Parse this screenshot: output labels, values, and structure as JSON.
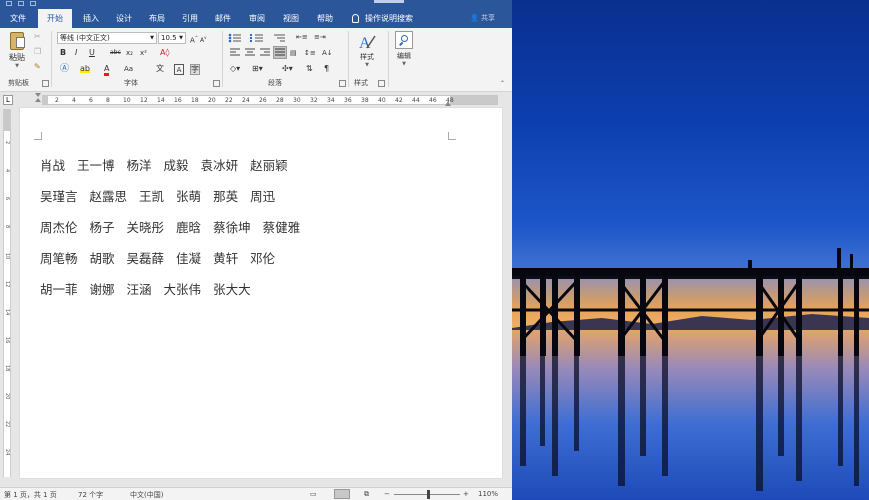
{
  "tabs": [
    {
      "label": "文件",
      "active": false
    },
    {
      "label": "开始",
      "active": true
    },
    {
      "label": "插入",
      "active": false
    },
    {
      "label": "设计",
      "active": false
    },
    {
      "label": "布局",
      "active": false
    },
    {
      "label": "引用",
      "active": false
    },
    {
      "label": "邮件",
      "active": false
    },
    {
      "label": "审阅",
      "active": false
    },
    {
      "label": "视图",
      "active": false
    },
    {
      "label": "帮助",
      "active": false
    }
  ],
  "tell_me": "操作说明搜索",
  "share": "共享",
  "ribbon": {
    "paste_label": "粘贴",
    "font_name": "等线 (中文正文)",
    "font_size": "10.5",
    "styles_label": "样式",
    "edit_label": "编辑",
    "groups": {
      "clipboard": "剪贴板",
      "font": "字体",
      "paragraph": "段落",
      "styles": "样式"
    },
    "font_buttons": {
      "bold": "B",
      "italic": "I",
      "underline": "U",
      "strike": "abc",
      "subscript": "x₂",
      "superscript": "x²",
      "clear": "A",
      "font_color": "A",
      "grow": "A",
      "shrink": "A",
      "change_case": "Aa",
      "phonetic": "文",
      "border": "A"
    }
  },
  "ruler_numbers": [
    "2",
    "4",
    "6",
    "8",
    "10",
    "12",
    "14",
    "16",
    "18",
    "20",
    "22",
    "24",
    "26",
    "28",
    "30",
    "32",
    "34",
    "36",
    "38",
    "40",
    "42",
    "44",
    "46",
    "48"
  ],
  "vruler_numbers": [
    "2",
    "4",
    "6",
    "8",
    "10",
    "12",
    "14",
    "16",
    "18",
    "20",
    "22",
    "24"
  ],
  "document": {
    "lines": [
      [
        "肖战",
        "王一博",
        "杨洋",
        "成毅",
        "袁冰妍",
        "赵丽颖"
      ],
      [
        "吴瑾言",
        "赵露思",
        "王凯",
        "张萌",
        "那英",
        "周迅"
      ],
      [
        "周杰伦",
        "杨子",
        "关晓彤",
        "鹿晗",
        "蔡徐坤",
        "蔡健雅"
      ],
      [
        "周笔畅",
        "胡歌",
        "吴磊薛",
        "佳凝",
        "黄轩",
        "邓伦"
      ],
      [
        "胡一菲",
        "谢娜",
        "汪涵",
        "大张伟",
        "张大大"
      ]
    ]
  },
  "status": {
    "page": "第 1 页，共 1 页",
    "words": "72 个字",
    "language": "中文(中国)",
    "zoom": "110%"
  },
  "colors": {
    "accent": "#2b579a",
    "ribbon_bg": "#f3f3f3",
    "workspace": "#e6e6e6"
  }
}
